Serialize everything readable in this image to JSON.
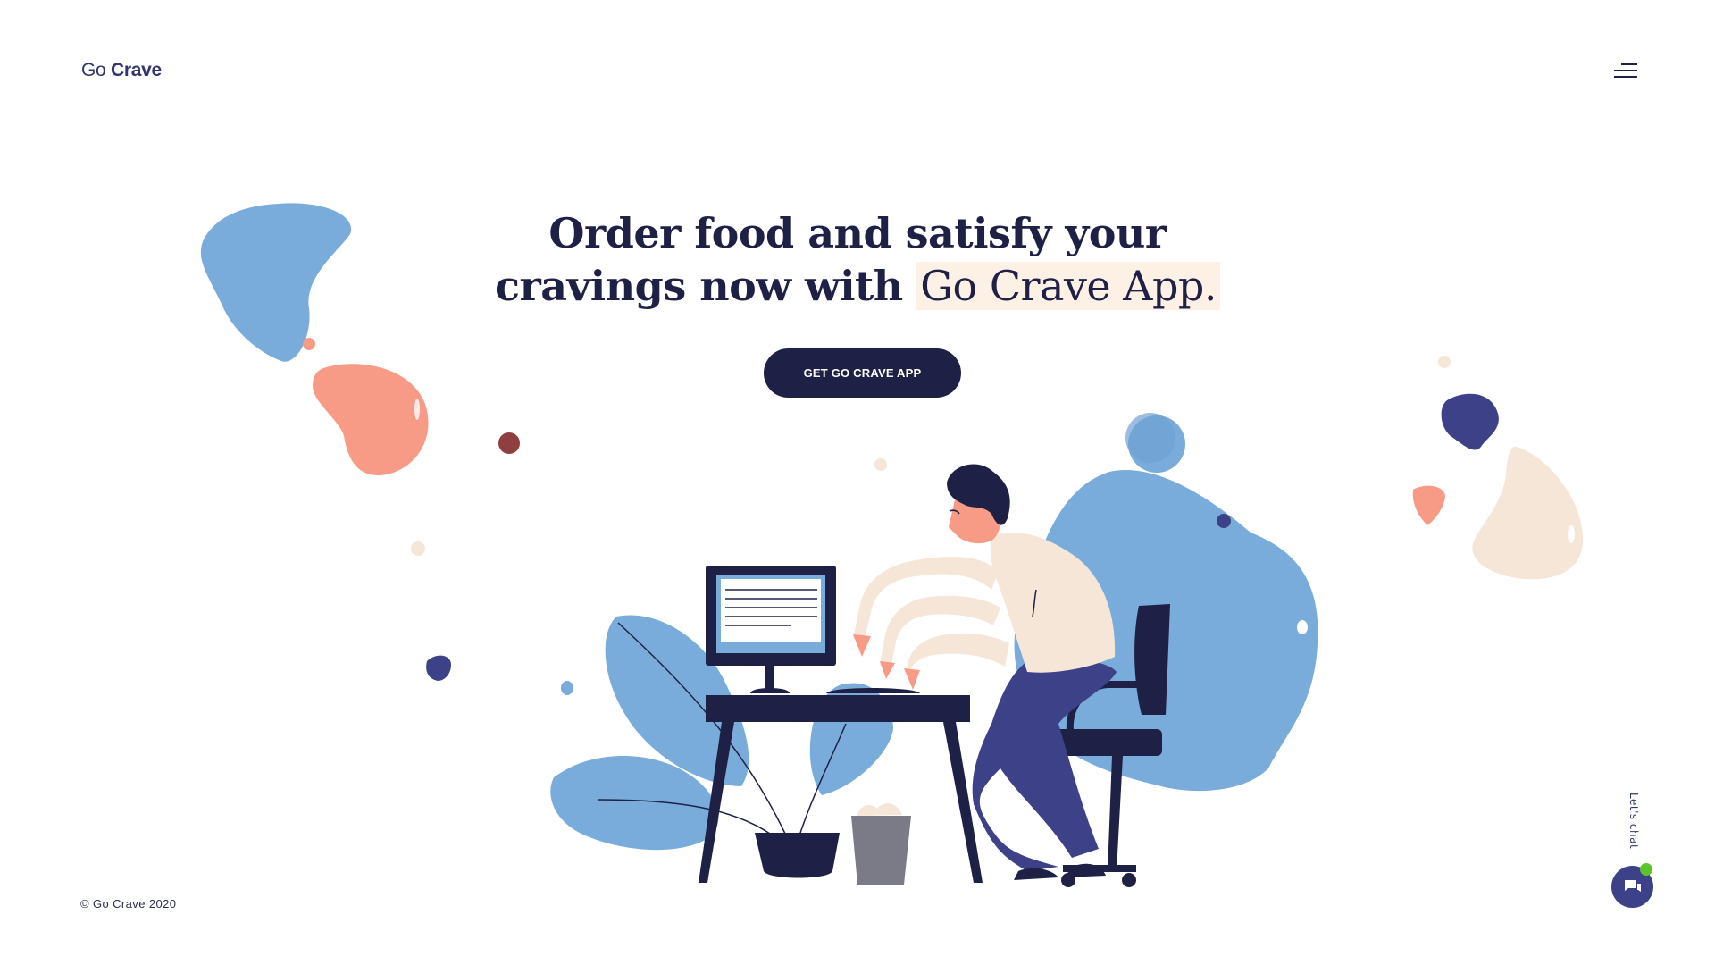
{
  "brand": {
    "logo_prefix": "Go",
    "logo_name": "Crave"
  },
  "header": {
    "menu_icon": "menu-icon"
  },
  "hero": {
    "headline_line1": "Order food and satisfy your",
    "headline_line2_prefix": "cravings now with",
    "headline_highlight": "Go Crave App",
    "headline_suffix": ".",
    "cta_label": "GET GO CRAVE APP"
  },
  "footer": {
    "copyright": "© Go Crave 2020"
  },
  "chat": {
    "label": "Let's chat",
    "icon": "chat-icon",
    "status": "online"
  },
  "colors": {
    "navy": "#1f2046",
    "indigo": "#3d4188",
    "blue": "#79acda",
    "coral": "#f79b86",
    "cream": "#f6e6d7",
    "online": "#5dc52b"
  }
}
